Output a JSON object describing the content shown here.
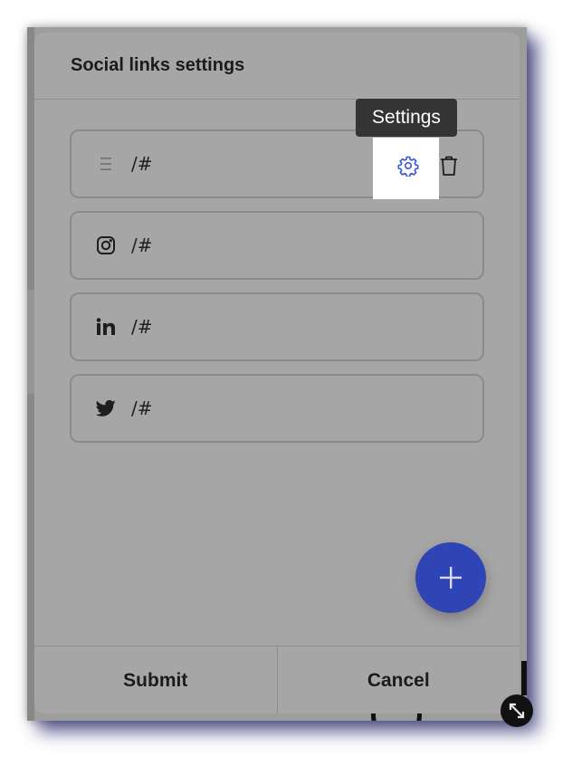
{
  "dialog": {
    "title": "Social links settings"
  },
  "links": [
    {
      "icon": "drag-handle-icon",
      "url": "/#"
    },
    {
      "icon": "instagram-icon",
      "url": "/#"
    },
    {
      "icon": "linkedin-icon",
      "url": "/#"
    },
    {
      "icon": "twitter-icon",
      "url": "/#"
    }
  ],
  "tooltip": {
    "text": "Settings"
  },
  "footer": {
    "submit_label": "Submit",
    "cancel_label": "Cancel"
  },
  "colors": {
    "accent": "#2f45b5",
    "gear": "#3a57d6",
    "dialog_bg": "#a6a6a6",
    "tooltip_bg": "#343434"
  }
}
